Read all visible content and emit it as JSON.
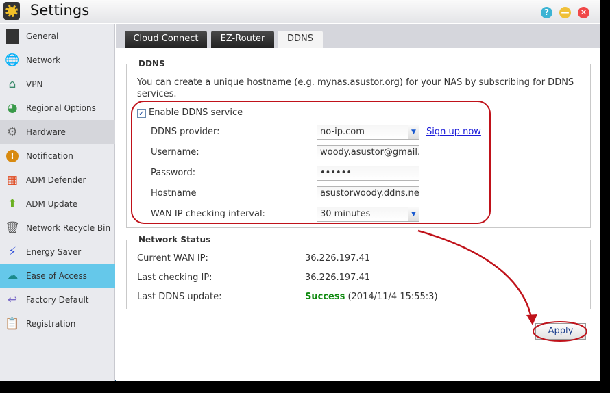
{
  "window": {
    "title": "Settings",
    "buttons": [
      "help",
      "minimize",
      "close"
    ]
  },
  "sidebar": {
    "items": [
      {
        "label": "General",
        "icon": "nas-icon"
      },
      {
        "label": "Network",
        "icon": "globe-icon"
      },
      {
        "label": "VPN",
        "icon": "house-network-icon"
      },
      {
        "label": "Regional Options",
        "icon": "globe-pin-icon"
      },
      {
        "label": "Hardware",
        "icon": "wrench-icon"
      },
      {
        "label": "Notification",
        "icon": "alert-icon"
      },
      {
        "label": "ADM Defender",
        "icon": "firewall-icon"
      },
      {
        "label": "ADM Update",
        "icon": "arrow-up-icon"
      },
      {
        "label": "Network Recycle Bin",
        "icon": "trash-icon"
      },
      {
        "label": "Energy Saver",
        "icon": "lightning-icon"
      },
      {
        "label": "Ease of Access",
        "icon": "cloud-upload-icon"
      },
      {
        "label": "Factory Default",
        "icon": "undo-icon"
      },
      {
        "label": "Registration",
        "icon": "clipboard-icon"
      }
    ],
    "selected": "Ease of Access",
    "hovered": "Hardware"
  },
  "tabs": [
    {
      "label": "Cloud Connect"
    },
    {
      "label": "EZ-Router"
    },
    {
      "label": "DDNS",
      "active": true
    }
  ],
  "ddns": {
    "legend": "DDNS",
    "description": "You can create a unique hostname (e.g. mynas.asustor.org) for your NAS by subscribing for DDNS services.",
    "enable_label": "Enable DDNS service",
    "enabled": true,
    "provider_label": "DDNS provider:",
    "provider_value": "no-ip.com",
    "signup_link": "Sign up now",
    "username_label": "Username:",
    "username_value": "woody.asustor@gmail.",
    "password_label": "Password:",
    "password_value": "••••••",
    "hostname_label": "Hostname",
    "hostname_value": "asustorwoody.ddns.ne",
    "interval_label": "WAN IP checking interval:",
    "interval_value": "30 minutes"
  },
  "status": {
    "legend": "Network Status",
    "wan_ip_label": "Current WAN IP:",
    "wan_ip_value": "36.226.197.41",
    "last_check_label": "Last checking IP:",
    "last_check_value": "36.226.197.41",
    "last_update_label": "Last DDNS update:",
    "last_update_status": "Success",
    "last_update_time": "(2014/11/4 15:55:3)",
    "success_color": "#108a10"
  },
  "apply_label": "Apply",
  "colors": {
    "selected": "#65c8ea",
    "annotation": "#c0121a"
  }
}
